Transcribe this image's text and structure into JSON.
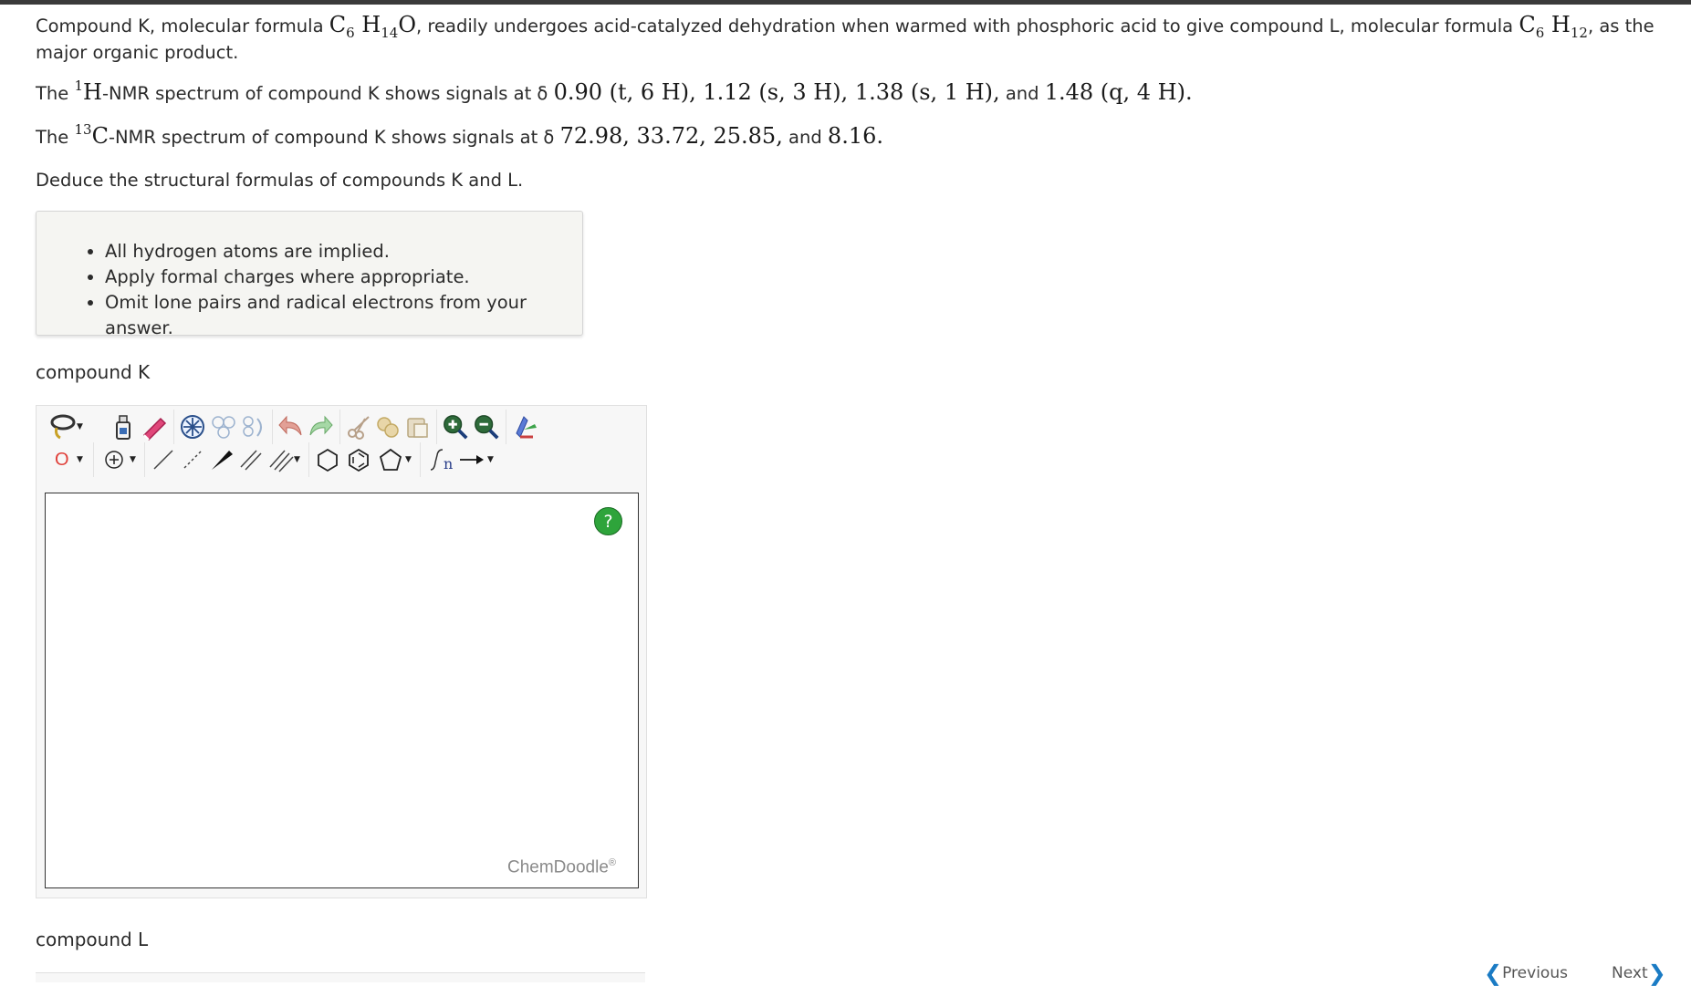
{
  "question": {
    "p1": {
      "t1": "Compound K, molecular formula ",
      "f1": {
        "c": "C",
        "c_sub": "6",
        "h": "H",
        "h_sub": "14",
        "o": "O"
      },
      "t2": ", readily undergoes acid-catalyzed dehydration when warmed with phosphoric acid to give compound L, molecular formula ",
      "f2": {
        "c": "C",
        "c_sub": "6",
        "h": "H",
        "h_sub": "12"
      },
      "t3": ", as the major organic product."
    },
    "p2": {
      "t1": "The ",
      "sup": "1",
      "nucleus": "H",
      "t2": "-NMR spectrum of compound K shows signals at δ ",
      "signals": "0.90  (t, 6 H), 1.12  (s, 3 H), 1.38  (s, 1 H),",
      "and": " and ",
      "last": "1.48  (q, 4 H)."
    },
    "p3": {
      "t1": "The ",
      "sup": "13",
      "nucleus": "C",
      "t2": "-NMR spectrum of compound K shows signals at δ ",
      "signals": "72.98, 33.72, 25.85,",
      "and": " and ",
      "last": "8.16."
    },
    "p4": "Deduce the structural formulas of compounds K and L."
  },
  "hints": [
    "All hydrogen atoms are implied.",
    "Apply formal charges where appropriate.",
    "Omit lone pairs and radical electrons from your answer."
  ],
  "compound_k_label": "compound K",
  "compound_l_label": "compound L",
  "editor": {
    "atom_label": "O",
    "help_label": "?",
    "brand": "ChemDoodle",
    "brand_mark": "®",
    "bracket_label": "n"
  },
  "nav": {
    "previous": "Previous",
    "next": "Next",
    "prev_arrow": "❮",
    "next_arrow": "❯"
  },
  "colors": {
    "help": "#2ea43b",
    "nav_arrow": "#1a7bc4",
    "eraser": "#e0477a"
  }
}
